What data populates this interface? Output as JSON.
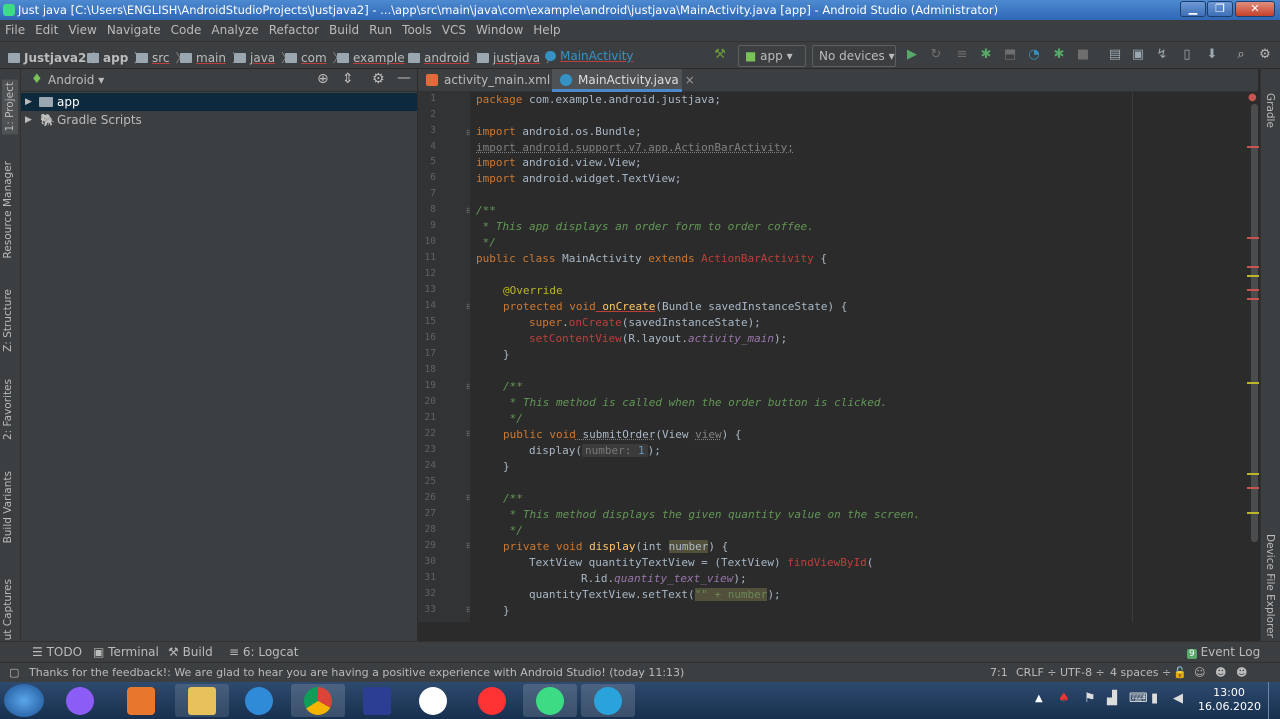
{
  "window": {
    "title": "Just java [C:\\Users\\ENGLISH\\AndroidStudioProjects\\Justjava2] - ...\\app\\src\\main\\java\\com\\example\\android\\justjava\\MainActivity.java [app] - Android Studio (Administrator)",
    "min": "▁",
    "max": "❐",
    "close": "✕"
  },
  "menu": [
    "File",
    "Edit",
    "View",
    "Navigate",
    "Code",
    "Analyze",
    "Refactor",
    "Build",
    "Run",
    "Tools",
    "VCS",
    "Window",
    "Help"
  ],
  "breadcrumbs": [
    "Justjava2",
    "app",
    "src",
    "main",
    "java",
    "com",
    "example",
    "android",
    "justjava",
    "MainActivity"
  ],
  "run_config": "app",
  "device": "No devices",
  "left_tabs": [
    "1: Project",
    "Resource Manager",
    "Z: Structure",
    "2: Favorites",
    "Build Variants",
    "Layout Captures"
  ],
  "right_tabs": [
    "Gradle",
    "Device File Explorer"
  ],
  "project": {
    "view": "Android",
    "tree": [
      "app",
      "Gradle Scripts"
    ]
  },
  "tabs": [
    "activity_main.xml",
    "MainActivity.java"
  ],
  "line_numbers": [
    "1",
    "2",
    "3",
    "4",
    "5",
    "6",
    "7",
    "8",
    "9",
    "10",
    "11",
    "12",
    "13",
    "14",
    "15",
    "16",
    "17",
    "18",
    "19",
    "20",
    "21",
    "22",
    "23",
    "24",
    "25",
    "26",
    "27",
    "28",
    "29",
    "30",
    "31",
    "32",
    "33"
  ],
  "code": {
    "l1a": "package",
    "l1b": " com.example.android.justjava;",
    "l3a": "import",
    "l3b": " android.os.Bundle;",
    "l4": "import android.support.v7.app.ActionBarActivity;",
    "l5a": "import",
    "l5b": " android.view.View;",
    "l6a": "import",
    "l6b": " android.widget.TextView;",
    "l8": "/**",
    "l9": " * This app displays an order form to order coffee.",
    "l10": " */",
    "l11a": "public class",
    "l11b": " MainActivity ",
    "l11c": "extends",
    "l11d": " ActionBarActivity",
    "l11e": " {",
    "l13": "@Override",
    "l14a": "protected void",
    "l14b": " onCreate",
    "l14c": "(Bundle savedInstanceState) {",
    "l15a": "super",
    "l15b": ".",
    "l15c": "onCreate",
    "l15d": "(savedInstanceState);",
    "l16a": "setContentView",
    "l16b": "(R.layout.",
    "l16c": "activity_main",
    "l16d": ");",
    "l17": "}",
    "l19": "/**",
    "l20": " * This method is called when the order button is clicked.",
    "l21": " */",
    "l22a": "public void",
    "l22b": " submitOrder",
    "l22c": "(View ",
    "l22d": "view",
    "l22e": ") {",
    "l23a": "display(",
    "l23b": "number:",
    "l23c": " 1",
    "l23d": ");",
    "l24": "}",
    "l26": "/**",
    "l27": " * This method displays the given quantity value on the screen.",
    "l28": " */",
    "l29a": "private void",
    "l29b": " display",
    "l29c": "(int ",
    "l29d": "number",
    "l29e": ") {",
    "l30a": "TextView quantityTextView = (TextView) ",
    "l30b": "findViewById",
    "l30c": "(",
    "l31a": "R.id.",
    "l31b": "quantity_text_view",
    "l31c": ");",
    "l32a": "quantityTextView.setText(",
    "l32b": "\"\" + number",
    "l32c": ");",
    "l33": "}"
  },
  "bottom_tools": [
    "TODO",
    "Terminal",
    "Build",
    "6: Logcat"
  ],
  "event_log": "Event Log",
  "status": {
    "message": "Thanks for the feedback!: We are glad to hear you are having a positive experience with Android Studio! (today 11:13)",
    "pos": "7:1",
    "crlf": "CRLF ÷",
    "enc": "UTF-8 ÷",
    "indent": "4 spaces ÷"
  },
  "clock": {
    "time": "13:00",
    "date": "16.06.2020"
  },
  "colors": {
    "accent": "#3592c4",
    "bg": "#2b2b2b",
    "panel": "#3c3f41"
  }
}
